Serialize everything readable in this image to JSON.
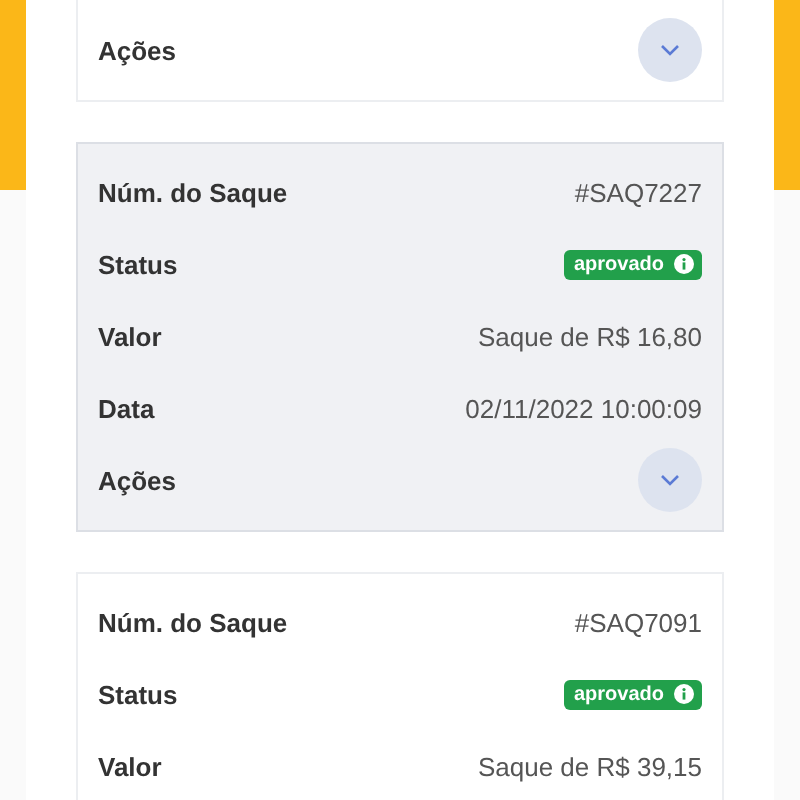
{
  "withdrawals": [
    {
      "highlighted": false,
      "actions_label": "Ações"
    },
    {
      "highlighted": true,
      "rows": [
        {
          "kind": "text",
          "label": "Núm. do Saque",
          "value": "#SAQ7227"
        },
        {
          "kind": "badge",
          "label": "Status",
          "value": "aprovado"
        },
        {
          "kind": "text",
          "label": "Valor",
          "value": "Saque de R$ 16,80"
        },
        {
          "kind": "text",
          "label": "Data",
          "value": "02/11/2022 10:00:09"
        }
      ],
      "actions_label": "Ações"
    },
    {
      "highlighted": false,
      "rows": [
        {
          "kind": "text",
          "label": "Núm. do Saque",
          "value": "#SAQ7091"
        },
        {
          "kind": "badge",
          "label": "Status",
          "value": "aprovado"
        },
        {
          "kind": "text",
          "label": "Valor",
          "value": "Saque de R$ 39,15"
        }
      ]
    }
  ]
}
